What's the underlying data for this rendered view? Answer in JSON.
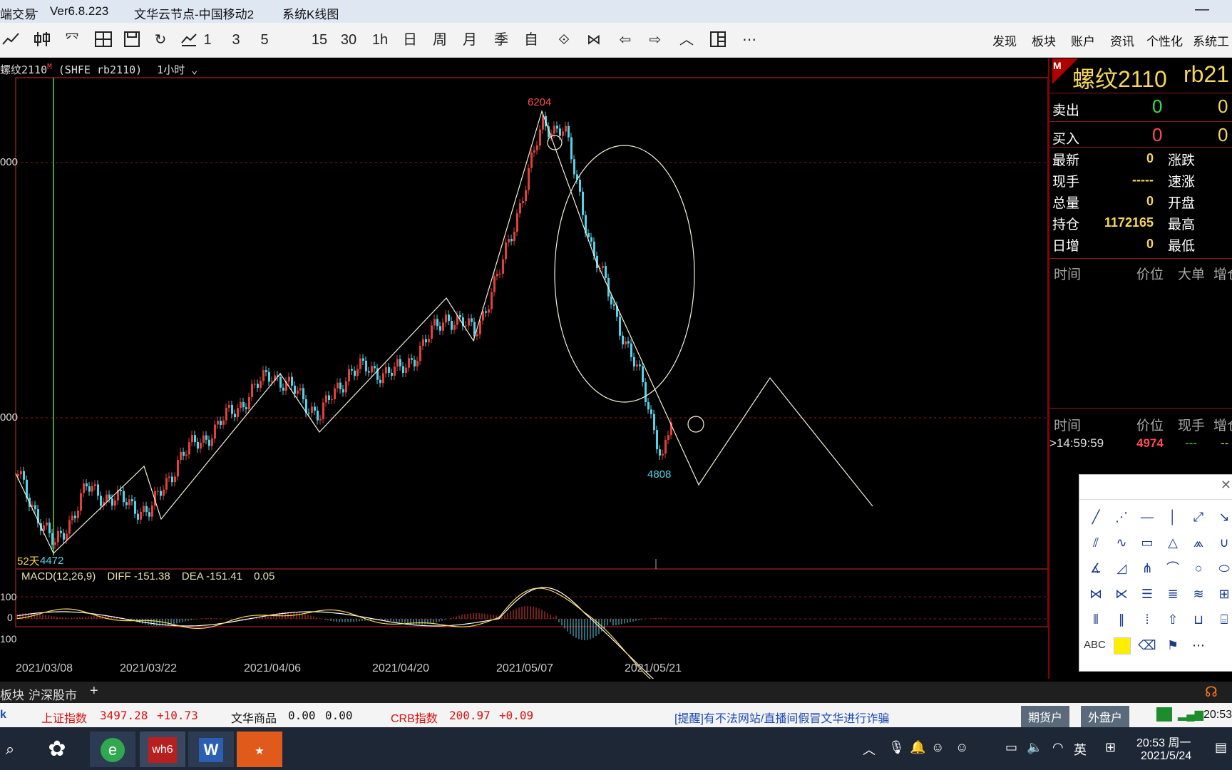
{
  "window": {
    "app_name": "端交易",
    "sep": "-",
    "version": "Ver6.8.223",
    "node": "文华云节点-中国移动2",
    "view": "系统K线图",
    "minimize": "—"
  },
  "toolbar": {
    "periods": [
      "1",
      "3",
      "5",
      "15",
      "30",
      "1h",
      "日",
      "周",
      "月",
      "季",
      "自"
    ],
    "right_menu": [
      "发现",
      "板块",
      "账户",
      "资讯",
      "个性化",
      "系统工"
    ]
  },
  "chart": {
    "contract_name": "螺纹2110",
    "contract_mark": "M",
    "contract_code": "(SHFE rb2110)",
    "period": "1小时",
    "y_labels": [
      "000",
      "000"
    ],
    "label_days": "52天",
    "price_high": "6204",
    "price_low_left": "4472",
    "price_low_right": "4808",
    "macd": {
      "name": "MACD(12,26,9)",
      "diff": "DIFF -151.38",
      "dea": "DEA -151.41",
      "macd": "0.05",
      "y_labels": [
        "100",
        "0",
        "100"
      ]
    },
    "x_dates": [
      "2021/03/08",
      "2021/03/22",
      "2021/04/06",
      "2021/04/20",
      "2021/05/07",
      "2021/05/21"
    ]
  },
  "quote_panel": {
    "flag": "M",
    "title": "螺纹2110",
    "title_code": "rb21",
    "sell_label": "卖出",
    "sell_price": "0",
    "sell_vol": "0",
    "buy_label": "买入",
    "buy_price": "0",
    "buy_vol": "0",
    "rows": [
      {
        "label": "最新",
        "value": "0",
        "label2": "涨跌"
      },
      {
        "label": "现手",
        "value": "-----",
        "label2": "速涨"
      },
      {
        "label": "总量",
        "value": "0",
        "label2": "开盘"
      },
      {
        "label": "持仓",
        "value": "1172165",
        "label2": "最高"
      },
      {
        "label": "日增",
        "value": "0",
        "label2": "最低"
      }
    ],
    "table1_headers": [
      "时间",
      "价位",
      "大单",
      "增仓"
    ],
    "table2_headers": [
      "时间",
      "价位",
      "现手",
      "增仓"
    ],
    "tick_time": ">14:59:59",
    "tick_price": "4974",
    "tick_vol": "---",
    "tick_inc": "--"
  },
  "draw_tools": {
    "close": "✕",
    "abc": "ABC",
    "more": "⋯"
  },
  "tabs": [
    "板块",
    "沪深股市",
    "+"
  ],
  "ticker": {
    "k": "k",
    "sh_name": "上证指数",
    "sh_value": "3497.28",
    "sh_change": "+10.73",
    "wh_name": "文华商品",
    "wh_value": "0.00",
    "wh_change": "0.00",
    "crb_name": "CRB指数",
    "crb_value": "200.97",
    "crb_change": "+0.09",
    "notice": "[提醒]有不法网站/直播间假冒文华进行诈骗",
    "btn_futures": "期货户",
    "btn_foreign": "外盘户",
    "time": "20:53"
  },
  "taskbar": {
    "ime": "英",
    "time": "20:53 周一",
    "date": "2021/5/24"
  },
  "colors": {
    "up": "#e0413a",
    "down": "#56d2e8",
    "grid": "#8b1a1a",
    "title_bar": "#dfe7f3"
  }
}
